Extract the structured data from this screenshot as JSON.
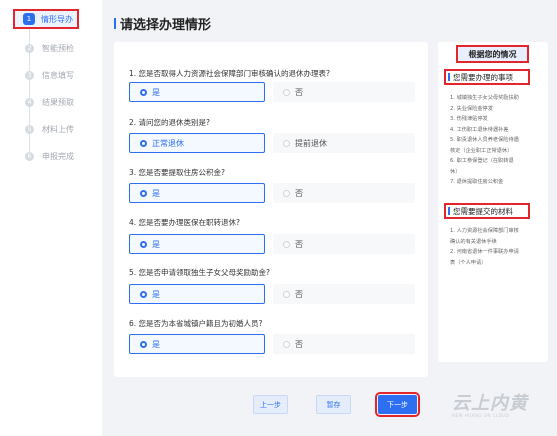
{
  "sidebar": {
    "steps": [
      {
        "num": "1",
        "label": "情形导办"
      },
      {
        "num": "2",
        "label": "智能预检"
      },
      {
        "num": "3",
        "label": "信息填写"
      },
      {
        "num": "4",
        "label": "结果预取"
      },
      {
        "num": "5",
        "label": "材料上传"
      },
      {
        "num": "6",
        "label": "申报完成"
      }
    ]
  },
  "page_title": "请选择办理情形",
  "questions": [
    {
      "text": "1. 您是否取得人力资源社会保障部门审核确认的退休办理表?",
      "selected": "是",
      "other": "否"
    },
    {
      "text": "2. 请问您的退休类别是?",
      "selected": "正常退休",
      "other": "提前退休"
    },
    {
      "text": "3. 您是否要提取住房公积金?",
      "selected": "是",
      "other": "否"
    },
    {
      "text": "4. 您是否要办理医保在职转退休?",
      "selected": "是",
      "other": "否"
    },
    {
      "text": "5. 您是否申请领取独生子女父母奖励助金?",
      "selected": "是",
      "other": "否"
    },
    {
      "text": "6. 您是否为本省城镇户籍且为初婚人员?",
      "selected": "是",
      "other": "否"
    }
  ],
  "buttons": {
    "prev": "上一步",
    "save": "暂存",
    "next": "下一步"
  },
  "panel": {
    "title": "根据您的情况",
    "matters_title": "您需要办理的事项",
    "matters": [
      "1. 城镇独生子女父母奖励扶助",
      "2. 失业保险金停发",
      "3. 伤残津贴停发",
      "4. 工伤职工退休待遇补差",
      "5. 职责退休人员养老保险待遇",
      "核定（企业职工正常退休）",
      "6. 职工参保登记（在职转退",
      "休）",
      "7. 退休提取住房公积金"
    ],
    "materials_title": "您需要提交的材料",
    "materials": [
      "1. 人力资源社会保障部门审核",
      "确认的有关退休手续",
      "2. 河南省退休一件事联办申请",
      "表（个人申请）"
    ]
  },
  "watermark": {
    "big": "云上内黄",
    "small": "NEW HUANG ON CLOUD"
  }
}
